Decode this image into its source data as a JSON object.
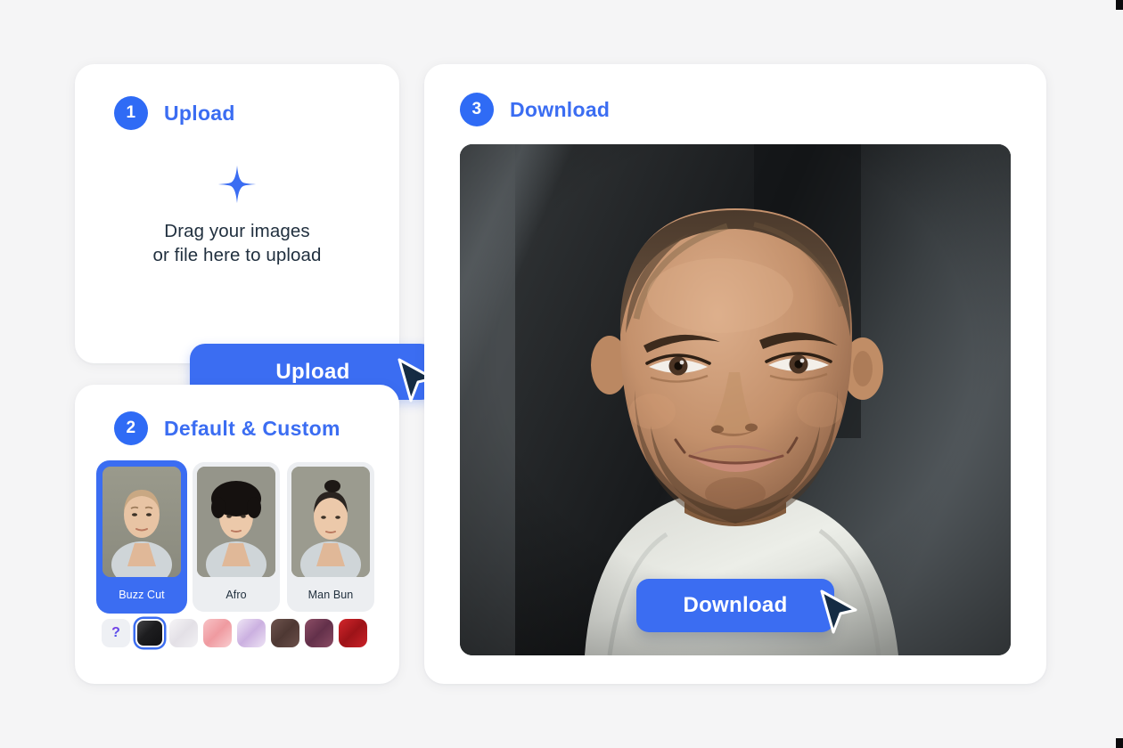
{
  "colors": {
    "page_bg": "#f5f5f6",
    "card_bg": "#ffffff",
    "accent": "#3b6df2",
    "badge": "#2f6bf5",
    "text_dark": "#21303f",
    "tile_bg": "#eceef1"
  },
  "steps": {
    "upload": {
      "number": "1",
      "title": "Upload",
      "drop_line1": "Drag your images",
      "drop_line2": "or file here to upload",
      "button_label": "Upload",
      "sparkle_icon": "sparkle-plus-icon"
    },
    "styles": {
      "number": "2",
      "title": "Default & Custom",
      "tiles": [
        {
          "label": "Buzz Cut",
          "selected": true
        },
        {
          "label": "Afro",
          "selected": false
        },
        {
          "label": "Man Bun",
          "selected": false
        }
      ],
      "swatches": [
        {
          "name": "custom-color-picker",
          "glyph": "?",
          "color": "#eef0f4",
          "selected": false
        },
        {
          "name": "black",
          "color": "#1d1d1f",
          "selected": true
        },
        {
          "name": "platinum-white",
          "color": "#eceaee",
          "selected": false
        },
        {
          "name": "rose-pink",
          "color": "#f4a8ad",
          "selected": false
        },
        {
          "name": "lavender",
          "color": "#ddc7ea",
          "selected": false
        },
        {
          "name": "dark-brown",
          "color": "#5e4440",
          "selected": false
        },
        {
          "name": "plum",
          "color": "#7c4158",
          "selected": false
        },
        {
          "name": "red",
          "color": "#bb1f24",
          "selected": false
        }
      ]
    },
    "download": {
      "number": "3",
      "title": "Download",
      "button_label": "Download",
      "result_alt": "portrait-result-buzz-cut"
    }
  },
  "cursors": {
    "upload_cursor": "arrow-cursor",
    "download_cursor": "arrow-cursor"
  }
}
